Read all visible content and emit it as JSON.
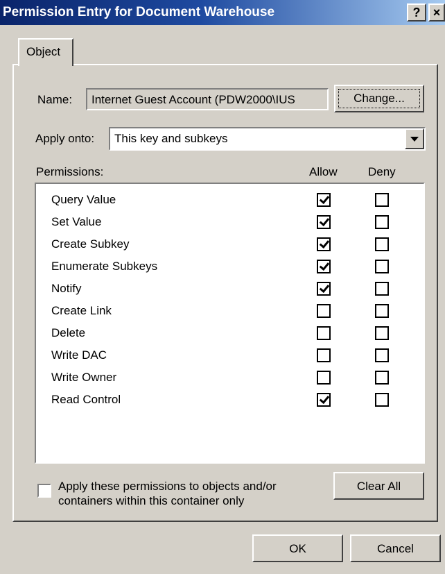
{
  "window": {
    "title": "Permission Entry for Document Warehouse",
    "help": "?",
    "close": "×"
  },
  "tab": {
    "label": "Object"
  },
  "name": {
    "label": "Name:",
    "value": "Internet Guest Account (PDW2000\\IUS",
    "change_button": "Change..."
  },
  "apply_onto": {
    "label": "Apply onto:",
    "value": "This key and subkeys"
  },
  "permissions": {
    "label": "Permissions:",
    "allow_header": "Allow",
    "deny_header": "Deny",
    "rows": [
      {
        "name": "Query Value",
        "allow": true,
        "deny": false
      },
      {
        "name": "Set Value",
        "allow": true,
        "deny": false
      },
      {
        "name": "Create Subkey",
        "allow": true,
        "deny": false
      },
      {
        "name": "Enumerate Subkeys",
        "allow": true,
        "deny": false
      },
      {
        "name": "Notify",
        "allow": true,
        "deny": false
      },
      {
        "name": "Create Link",
        "allow": false,
        "deny": false
      },
      {
        "name": "Delete",
        "allow": false,
        "deny": false
      },
      {
        "name": "Write DAC",
        "allow": false,
        "deny": false
      },
      {
        "name": "Write Owner",
        "allow": false,
        "deny": false
      },
      {
        "name": "Read Control",
        "allow": true,
        "deny": false
      }
    ]
  },
  "apply_within": {
    "line1": "Apply these permissions to objects and/or",
    "line2": "containers within this container only",
    "checked": false
  },
  "buttons": {
    "clear_all": "Clear All",
    "ok": "OK",
    "cancel": "Cancel"
  }
}
